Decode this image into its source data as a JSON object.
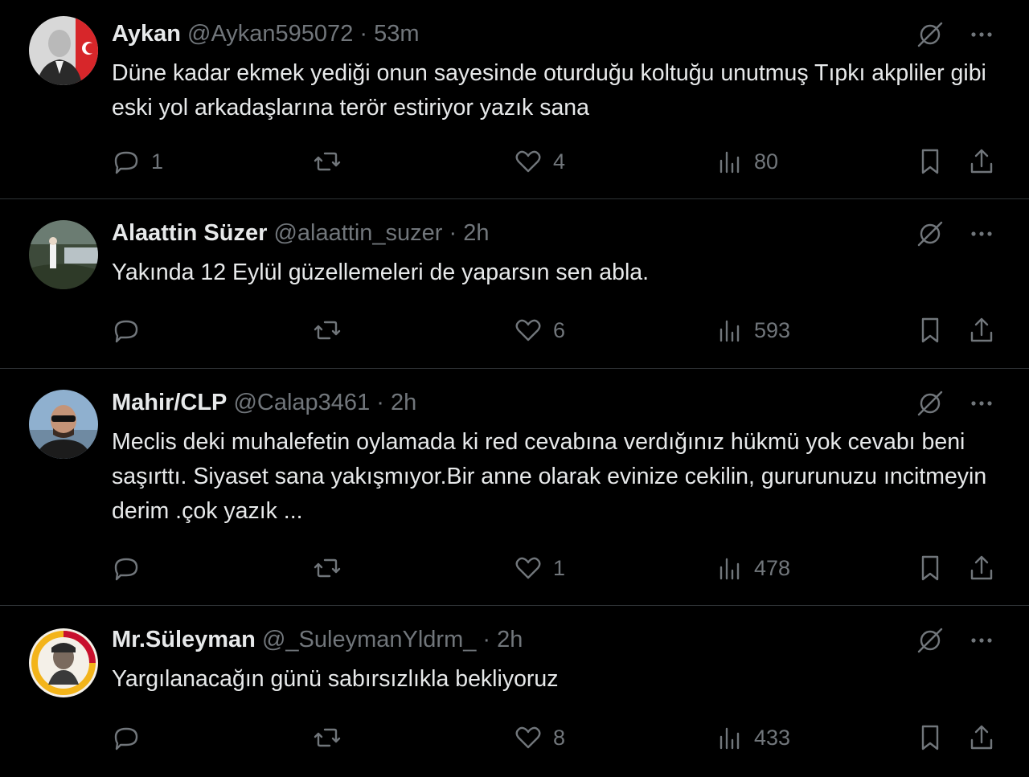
{
  "tweets": [
    {
      "name": "Aykan",
      "handle": "@Aykan595072",
      "time": "53m",
      "text": "Düne kadar ekmek yediği onun sayesinde oturduğu koltuğu unutmuş Tıpkı akpliler gibi eski yol arkadaşlarına terör estiriyor yazık sana",
      "replies": "1",
      "retweets": "",
      "likes": "4",
      "views": "80"
    },
    {
      "name": "Alaattin Süzer",
      "handle": "@alaattin_suzer",
      "time": "2h",
      "text": "Yakında 12 Eylül güzellemeleri de yaparsın sen abla.",
      "replies": "",
      "retweets": "",
      "likes": "6",
      "views": "593"
    },
    {
      "name": "Mahir/CLP",
      "handle": "@Calap3461",
      "time": "2h",
      "text": "Meclis deki muhalefetin oylamada ki red cevabına verdığınız  hükmü yok cevabı beni saşırttı. Siyaset sana yakışmıyor.Bir anne olarak evinize cekilin, gururunuzu ıncitmeyin derim .çok yazık ...",
      "replies": "",
      "retweets": "",
      "likes": "1",
      "views": "478"
    },
    {
      "name": "Mr.Süleyman",
      "handle": "@_SuleymanYldrm_",
      "time": "2h",
      "text": "Yargılanacağın günü sabırsızlıkla bekliyoruz",
      "replies": "",
      "retweets": "",
      "likes": "8",
      "views": "433"
    }
  ],
  "separator": "·",
  "icons": {
    "grok": "slashed-circle-icon",
    "more": "more-dots-icon",
    "reply": "reply-bubble-icon",
    "retweet": "retweet-icon",
    "like": "heart-icon",
    "views": "bar-chart-icon",
    "bookmark": "bookmark-icon",
    "share": "share-icon"
  },
  "colors": {
    "background": "#000000",
    "text": "#e7e9ea",
    "muted": "#71767b",
    "divider": "#2f3336"
  }
}
